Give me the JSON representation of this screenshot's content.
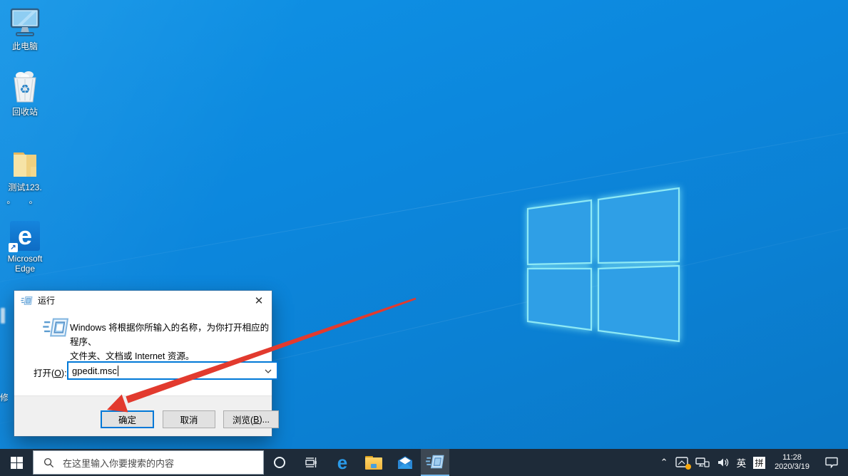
{
  "colors": {
    "desktop_blue": "#0c86dc",
    "taskbar_bg": "#1e2b39",
    "focus_blue": "#0078d7",
    "arrow_red": "#e23a2e",
    "logo_pane_fill": "#2f9fe6",
    "logo_pane_edge": "#8ee9f5"
  },
  "desktop": {
    "icons": [
      {
        "label": "此电脑"
      },
      {
        "label": "回收站"
      },
      {
        "label": "测试123.",
        "label2": "。 。"
      },
      {
        "label": "Microsoft",
        "label2": "Edge"
      }
    ],
    "partial_label": "修"
  },
  "run_dialog": {
    "title": "运行",
    "close_glyph": "✕",
    "message_line1": "Windows 将根据你所输入的名称，为你打开相应的程序、",
    "message_line2": "文件夹、文档或 Internet 资源。",
    "open_label_pre": "打开(",
    "open_label_key": "O",
    "open_label_post": "):",
    "input_value": "gpedit.msc",
    "dropdown_glyph": "⌄",
    "buttons": {
      "ok": "确定",
      "cancel": "取消",
      "browse_pre": "浏览(",
      "browse_key": "B",
      "browse_post": ")..."
    }
  },
  "taskbar": {
    "search_placeholder": "在这里输入你要搜索的内容",
    "tray": {
      "chevron": "⌃",
      "ime_lang": "英",
      "ime_mode": "拼",
      "time": "11:28",
      "date": "2020/3/19"
    }
  }
}
